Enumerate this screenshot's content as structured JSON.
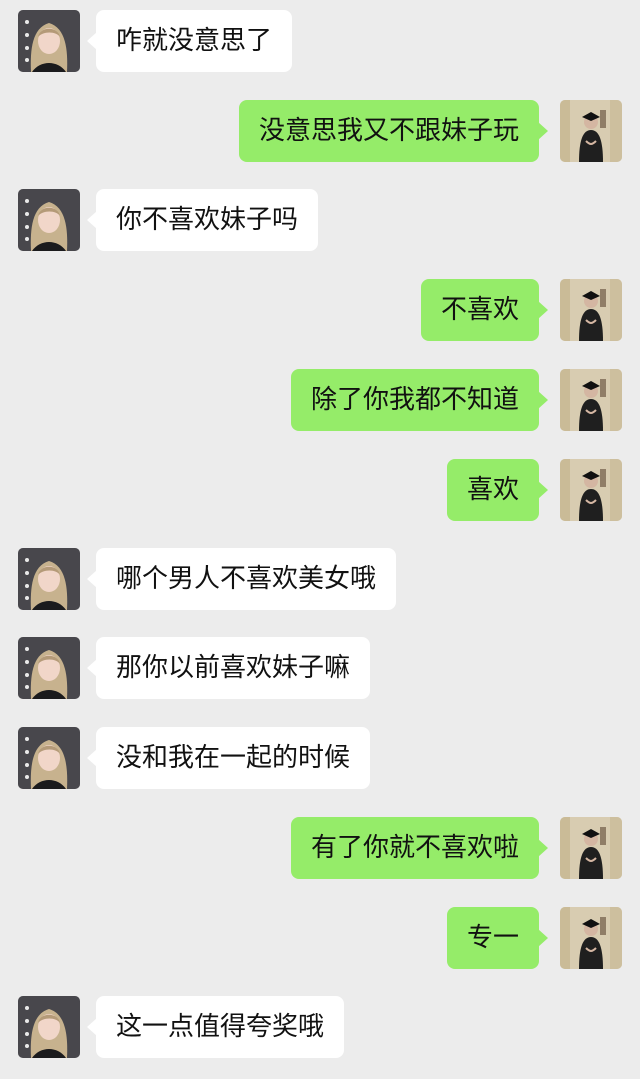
{
  "messages": [
    {
      "side": "in",
      "text": "咋就没意思了"
    },
    {
      "side": "out",
      "text": "没意思我又不跟妹子玩"
    },
    {
      "side": "in",
      "text": "你不喜欢妹子吗"
    },
    {
      "side": "out",
      "text": "不喜欢"
    },
    {
      "side": "out",
      "text": "除了你我都不知道"
    },
    {
      "side": "out",
      "text": "喜欢"
    },
    {
      "side": "in",
      "text": "哪个男人不喜欢美女哦"
    },
    {
      "side": "in",
      "text": "那你以前喜欢妹子嘛"
    },
    {
      "side": "in",
      "text": "没和我在一起的时候"
    },
    {
      "side": "out",
      "text": "有了你就不喜欢啦"
    },
    {
      "side": "out",
      "text": "专一"
    },
    {
      "side": "in",
      "text": "这一点值得夸奖哦"
    }
  ],
  "colors": {
    "background": "#ececec",
    "incoming_bubble": "#ffffff",
    "outgoing_bubble": "#95ec69"
  },
  "icons": {
    "incoming_avatar": "woman-portrait-avatar",
    "outgoing_avatar": "man-portrait-avatar"
  }
}
